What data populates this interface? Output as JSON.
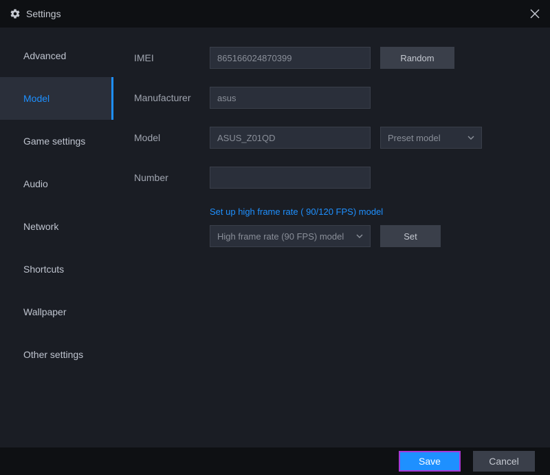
{
  "titlebar": {
    "title": "Settings"
  },
  "sidebar": {
    "items": [
      {
        "label": "Advanced",
        "active": false
      },
      {
        "label": "Model",
        "active": true
      },
      {
        "label": "Game settings",
        "active": false
      },
      {
        "label": "Audio",
        "active": false
      },
      {
        "label": "Network",
        "active": false
      },
      {
        "label": "Shortcuts",
        "active": false
      },
      {
        "label": "Wallpaper",
        "active": false
      },
      {
        "label": "Other settings",
        "active": false
      }
    ]
  },
  "form": {
    "imei_label": "IMEI",
    "imei_value": "865166024870399",
    "random_button": "Random",
    "manufacturer_label": "Manufacturer",
    "manufacturer_value": "asus",
    "model_label": "Model",
    "model_value": "ASUS_Z01QD",
    "preset_model_label": "Preset model",
    "number_label": "Number",
    "number_value": "",
    "frame_rate_link": "Set up high frame rate ( 90/120 FPS) model",
    "frame_rate_dropdown": "High frame rate (90 FPS) model",
    "set_button": "Set"
  },
  "footer": {
    "save": "Save",
    "cancel": "Cancel"
  }
}
